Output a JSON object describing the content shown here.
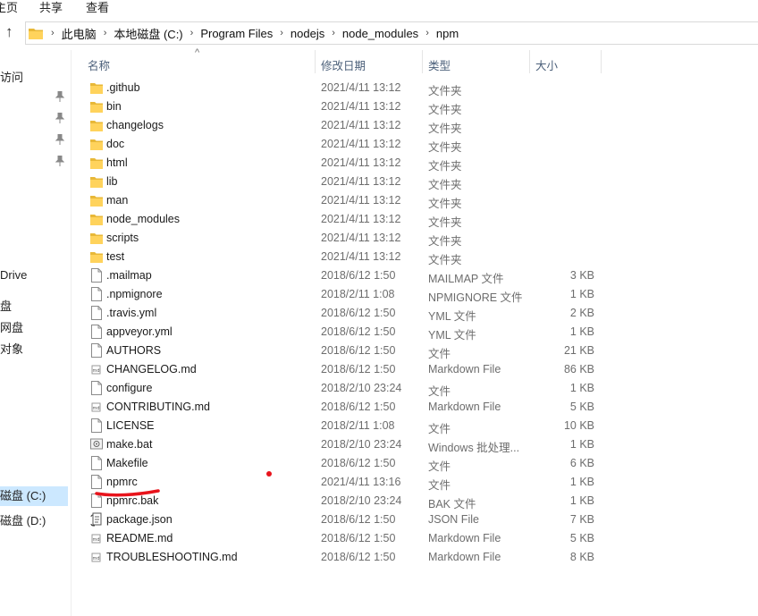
{
  "ribbon": {
    "tabs": [
      "主页",
      "共享",
      "查看"
    ]
  },
  "address": {
    "crumbs": [
      "此电脑",
      "本地磁盘 (C:)",
      "Program Files",
      "nodejs",
      "node_modules",
      "npm"
    ]
  },
  "nav": {
    "items": [
      "访问",
      "Drive",
      "盘",
      "网盘",
      "对象",
      "磁盘 (C:)",
      "磁盘 (D:)"
    ]
  },
  "columns": {
    "name": "名称",
    "date": "修改日期",
    "type": "类型",
    "size": "大小"
  },
  "files": [
    {
      "name": ".github",
      "date": "2021/4/11 13:12",
      "type": "文件夹",
      "size": "",
      "icon": "folder-icon"
    },
    {
      "name": "bin",
      "date": "2021/4/11 13:12",
      "type": "文件夹",
      "size": "",
      "icon": "folder-icon"
    },
    {
      "name": "changelogs",
      "date": "2021/4/11 13:12",
      "type": "文件夹",
      "size": "",
      "icon": "folder-icon"
    },
    {
      "name": "doc",
      "date": "2021/4/11 13:12",
      "type": "文件夹",
      "size": "",
      "icon": "folder-icon"
    },
    {
      "name": "html",
      "date": "2021/4/11 13:12",
      "type": "文件夹",
      "size": "",
      "icon": "folder-icon"
    },
    {
      "name": "lib",
      "date": "2021/4/11 13:12",
      "type": "文件夹",
      "size": "",
      "icon": "folder-icon"
    },
    {
      "name": "man",
      "date": "2021/4/11 13:12",
      "type": "文件夹",
      "size": "",
      "icon": "folder-icon"
    },
    {
      "name": "node_modules",
      "date": "2021/4/11 13:12",
      "type": "文件夹",
      "size": "",
      "icon": "folder-icon"
    },
    {
      "name": "scripts",
      "date": "2021/4/11 13:12",
      "type": "文件夹",
      "size": "",
      "icon": "folder-icon"
    },
    {
      "name": "test",
      "date": "2021/4/11 13:12",
      "type": "文件夹",
      "size": "",
      "icon": "folder-icon"
    },
    {
      "name": ".mailmap",
      "date": "2018/6/12 1:50",
      "type": "MAILMAP 文件",
      "size": "3 KB",
      "icon": "file-icon"
    },
    {
      "name": ".npmignore",
      "date": "2018/2/11 1:08",
      "type": "NPMIGNORE 文件",
      "size": "1 KB",
      "icon": "file-icon"
    },
    {
      "name": ".travis.yml",
      "date": "2018/6/12 1:50",
      "type": "YML 文件",
      "size": "2 KB",
      "icon": "file-icon"
    },
    {
      "name": "appveyor.yml",
      "date": "2018/6/12 1:50",
      "type": "YML 文件",
      "size": "1 KB",
      "icon": "file-icon"
    },
    {
      "name": "AUTHORS",
      "date": "2018/6/12 1:50",
      "type": "文件",
      "size": "21 KB",
      "icon": "file-icon"
    },
    {
      "name": "CHANGELOG.md",
      "date": "2018/6/12 1:50",
      "type": "Markdown File",
      "size": "86 KB",
      "icon": "markdown-file-icon"
    },
    {
      "name": "configure",
      "date": "2018/2/10 23:24",
      "type": "文件",
      "size": "1 KB",
      "icon": "file-icon"
    },
    {
      "name": "CONTRIBUTING.md",
      "date": "2018/6/12 1:50",
      "type": "Markdown File",
      "size": "5 KB",
      "icon": "markdown-file-icon"
    },
    {
      "name": "LICENSE",
      "date": "2018/2/11 1:08",
      "type": "文件",
      "size": "10 KB",
      "icon": "file-icon"
    },
    {
      "name": "make.bat",
      "date": "2018/2/10 23:24",
      "type": "Windows 批处理...",
      "size": "1 KB",
      "icon": "batch-file-icon"
    },
    {
      "name": "Makefile",
      "date": "2018/6/12 1:50",
      "type": "文件",
      "size": "6 KB",
      "icon": "file-icon"
    },
    {
      "name": "npmrc",
      "date": "2021/4/11 13:16",
      "type": "文件",
      "size": "1 KB",
      "icon": "file-icon"
    },
    {
      "name": "npmrc.bak",
      "date": "2018/2/10 23:24",
      "type": "BAK 文件",
      "size": "1 KB",
      "icon": "file-icon"
    },
    {
      "name": "package.json",
      "date": "2018/6/12 1:50",
      "type": "JSON File",
      "size": "7 KB",
      "icon": "json-file-icon"
    },
    {
      "name": "README.md",
      "date": "2018/6/12 1:50",
      "type": "Markdown File",
      "size": "5 KB",
      "icon": "markdown-file-icon"
    },
    {
      "name": "TROUBLESHOOTING.md",
      "date": "2018/6/12 1:50",
      "type": "Markdown File",
      "size": "8 KB",
      "icon": "markdown-file-icon"
    }
  ],
  "colors": {
    "folder": "#ffd35c",
    "selection": "#cce8ff",
    "header_text": "#4c607a",
    "annotation": "#e8141c"
  }
}
